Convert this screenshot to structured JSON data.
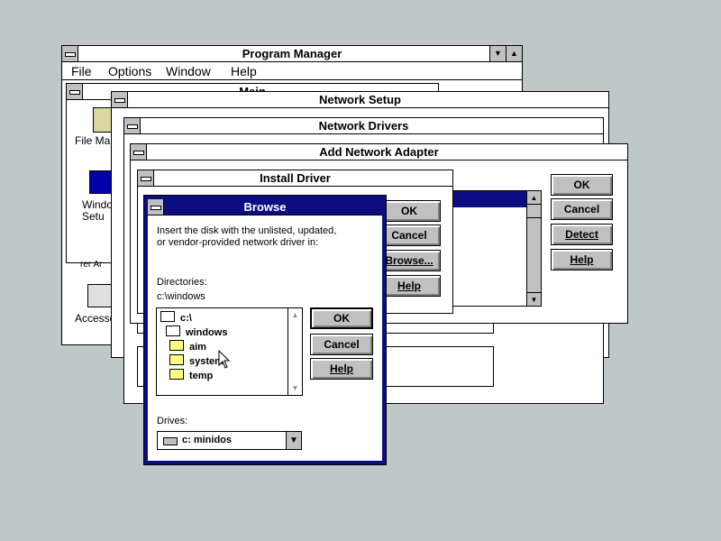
{
  "program_manager": {
    "title": "Program Manager",
    "menu": [
      "File",
      "Options",
      "Window",
      "Help"
    ],
    "main_group_title": "Main",
    "icons": [
      "File Man",
      "Windo Setu",
      "Accesso"
    ],
    "partial_text": "rer Ar"
  },
  "network_setup": {
    "title": "Network Setup"
  },
  "network_drivers": {
    "title": "Network Drivers"
  },
  "add_adapter": {
    "title": "Add Network Adapter",
    "buttons": {
      "ok": "OK",
      "cancel": "Cancel",
      "detect": "Detect",
      "help": "Help"
    }
  },
  "install_driver": {
    "title": "Install Driver",
    "buttons": {
      "ok": "OK",
      "cancel": "Cancel",
      "browse": "Browse...",
      "help": "Help"
    }
  },
  "browse": {
    "title": "Browse",
    "prompt_line1": "Insert the disk with the unlisted, updated,",
    "prompt_line2": "or vendor-provided network driver in:",
    "directories_label": "Directories:",
    "current_dir": "c:\\windows",
    "dirs": [
      {
        "name": "c:\\",
        "indent": 0,
        "open": true
      },
      {
        "name": "windows",
        "indent": 1,
        "open": true
      },
      {
        "name": "aim",
        "indent": 2,
        "open": false
      },
      {
        "name": "system",
        "indent": 2,
        "open": false
      },
      {
        "name": "temp",
        "indent": 2,
        "open": false
      }
    ],
    "drives_label": "Drives:",
    "drive_selected": "c: minidos",
    "buttons": {
      "ok": "OK",
      "cancel": "Cancel",
      "help": "Help"
    }
  },
  "colors": {
    "desktop": "#c0c7c8",
    "active_title": "#0d0d82",
    "selection": "#0d0d82"
  }
}
